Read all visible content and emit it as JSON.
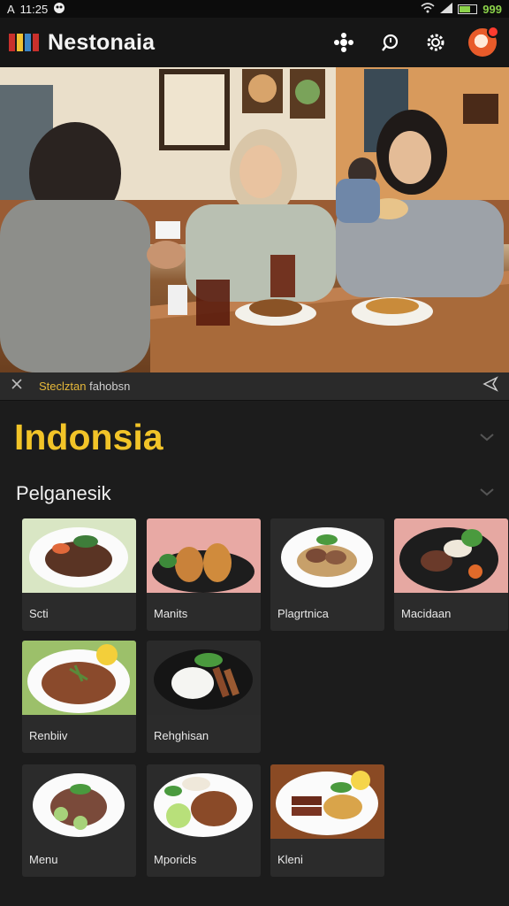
{
  "status": {
    "time": "11:25",
    "left_glyph": "A",
    "battery": "999"
  },
  "app": {
    "title": "Nestonaia"
  },
  "caption": {
    "prefix": "Steclztan",
    "rest": " fahobsn"
  },
  "country": "Indonsia",
  "section": "Pelganesik",
  "dishes": [
    {
      "label": "Scti"
    },
    {
      "label": "Manits"
    },
    {
      "label": "Plagrtnica"
    },
    {
      "label": "Macidaan"
    },
    {
      "label": "Renbiiv"
    },
    {
      "label": "Rehghisan"
    },
    {
      "label": "Menu"
    },
    {
      "label": "Mporicls"
    },
    {
      "label": "Kleni"
    }
  ],
  "colors": {
    "accent": "#f2c428",
    "card": "#2b2b2b",
    "background": "#1c1c1c"
  },
  "icons": [
    "network-icon",
    "search-icon",
    "gear-icon",
    "avatar",
    "close-icon",
    "share-icon",
    "chevron-down-icon"
  ]
}
